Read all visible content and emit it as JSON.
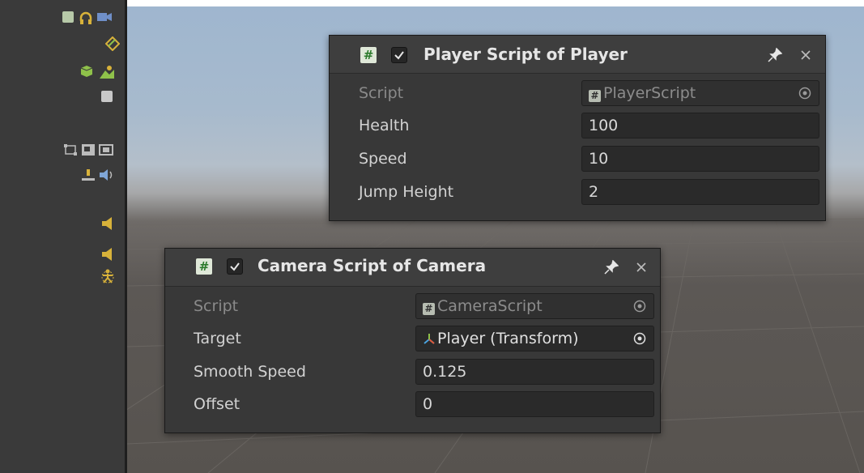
{
  "player_panel": {
    "title": "Player Script of Player",
    "enabled": true,
    "fields": [
      {
        "label": "Script",
        "value": "PlayerScript"
      },
      {
        "label": "Health",
        "value": "100"
      },
      {
        "label": "Speed",
        "value": "10"
      },
      {
        "label": "Jump Height",
        "value": "2"
      }
    ]
  },
  "camera_panel": {
    "title": "Camera Script of Camera",
    "enabled": true,
    "fields": [
      {
        "label": "Script",
        "value": "CameraScript"
      },
      {
        "label": "Target",
        "value": "Player (Transform)"
      },
      {
        "label": "Smooth Speed",
        "value": "0.125"
      },
      {
        "label": "Offset",
        "value": "0"
      }
    ]
  },
  "colors": {
    "panel_bg": "#383838",
    "field_bg": "#2a2a2a",
    "script_icon_green": "#2b7a2b",
    "gizmo_yellow": "#d8b23a",
    "gizmo_green": "#8fc14a"
  }
}
